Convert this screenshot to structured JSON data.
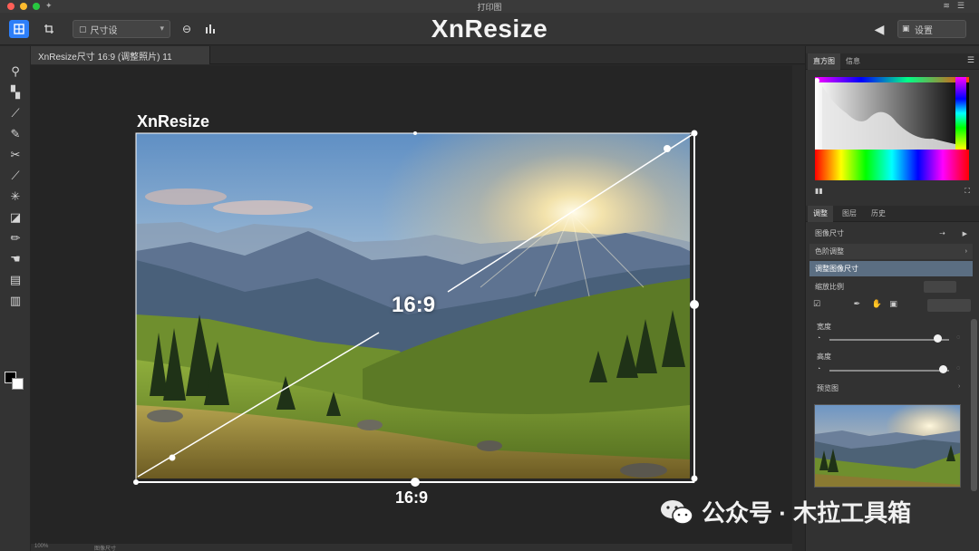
{
  "window": {
    "title": "打印图",
    "traffic_colors": [
      "#ff5f57",
      "#febc2e",
      "#28c840"
    ]
  },
  "toolbar": {
    "app_title": "XnResize",
    "dropdown_value": "尺寸设",
    "right_dropdown_value": "设置",
    "icons": [
      "layout-icon",
      "crop-icon",
      "mask-icon",
      "histogram-icon",
      "back-arrow-icon"
    ]
  },
  "tools": [
    "magnify-icon",
    "select-icon",
    "brush-icon",
    "pen-icon",
    "crop-tool-icon",
    "wand-icon",
    "sparkle-icon",
    "eraser-icon",
    "pencil-icon",
    "smudge-icon",
    "stamp-icon",
    "layers-icon"
  ],
  "document": {
    "tab_label": "XnResize尺寸 16:9 (调整照片) 11"
  },
  "canvas": {
    "label": "XnResize",
    "ratio_center": "16:9",
    "ratio_bottom": "16:9",
    "accent": "#ffffff"
  },
  "right_panel": {
    "top_tabs": [
      "直方图",
      "信息"
    ],
    "mid_tabs": [
      "调整",
      "图层",
      "历史"
    ],
    "rows": [
      {
        "label": "图像尺寸"
      },
      {
        "label": "色阶调整"
      },
      {
        "label": "调整图像尺寸"
      },
      {
        "label": "缩放比例"
      }
    ],
    "slider_labels": [
      "宽度",
      "高度"
    ],
    "slider_values": [
      0.9,
      0.95
    ],
    "section_label": "预览图"
  },
  "watermark": {
    "text": "公众号 · 木拉工具箱"
  },
  "status": {
    "left": "100%",
    "mid": "图像尺寸"
  }
}
